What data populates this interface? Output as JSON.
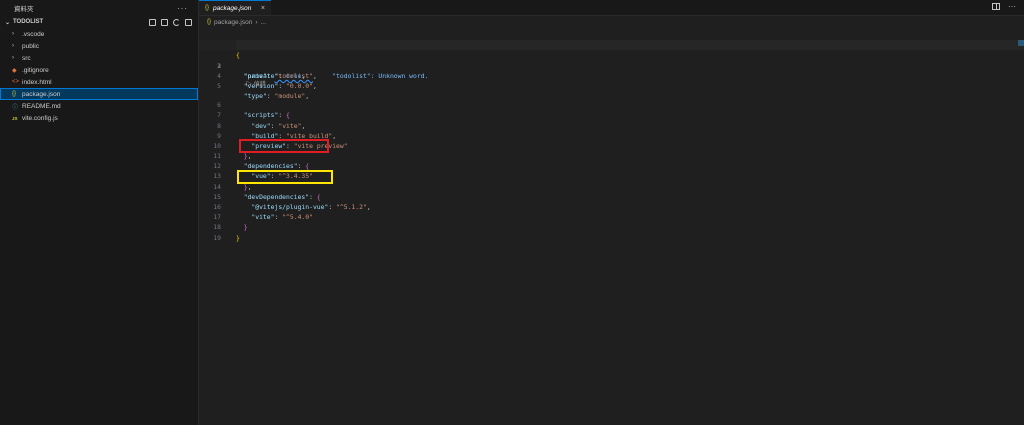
{
  "explorer": {
    "title": "資料夾",
    "more": "···",
    "folder": "TODOLIST",
    "items": [
      {
        "label": ".vscode",
        "icon": "chevron-right-icon",
        "glyph": "›"
      },
      {
        "label": "public",
        "icon": "chevron-right-icon",
        "glyph": "›"
      },
      {
        "label": "src",
        "icon": "chevron-right-icon",
        "glyph": "›"
      },
      {
        "label": ".gitignore",
        "icon": "git-icon",
        "glyph": "◆"
      },
      {
        "label": "index.html",
        "icon": "html-icon",
        "glyph": "<>"
      },
      {
        "label": "package.json",
        "icon": "json-icon",
        "glyph": "{}"
      },
      {
        "label": "README.md",
        "icon": "info-icon",
        "glyph": "ⓘ"
      },
      {
        "label": "vite.config.js",
        "icon": "js-icon",
        "glyph": "JS"
      }
    ]
  },
  "tab": {
    "label": "package.json",
    "close": "×",
    "glyph": "{}"
  },
  "breadcrumb": {
    "file": "package.json",
    "sep": "›",
    "rest": "..."
  },
  "lens": {
    "label": "偵錯",
    "glyph": "▷"
  },
  "code": {
    "lines": [
      "1",
      "2",
      "3",
      "4",
      "5",
      "6",
      "7",
      "8",
      "9",
      "10",
      "11",
      "12",
      "13",
      "14",
      "15",
      "16",
      "17",
      "18",
      "19"
    ],
    "open_brace": "{",
    "name_key": "\"name\"",
    "name_val": "\"todolist\"",
    "name_hint": "\"todolist\": Unknown word.",
    "private_key": "\"private\"",
    "private_val": "true",
    "version_key": "\"version\"",
    "version_val": "\"0.0.0\"",
    "type_key": "\"type\"",
    "type_val": "\"module\"",
    "scripts_key": "\"scripts\"",
    "dev_key": "\"dev\"",
    "dev_val": "\"vite\"",
    "build_key": "\"build\"",
    "build_val": "\"vite build\"",
    "preview_key": "\"preview\"",
    "preview_val": "\"vite preview\"",
    "deps_key": "\"dependencies\"",
    "vue_key": "\"vue\"",
    "vue_val": "\"^3.4.35\"",
    "devdeps_key": "\"devDependencies\"",
    "plugin_key": "\"@vitejs/plugin-vue\"",
    "plugin_val": "\"^5.1.2\"",
    "vite_key": "\"vite\"",
    "vite_val": "\"^5.4.0\"",
    "close_brace": "}",
    "colon": ": ",
    "comma": ","
  }
}
